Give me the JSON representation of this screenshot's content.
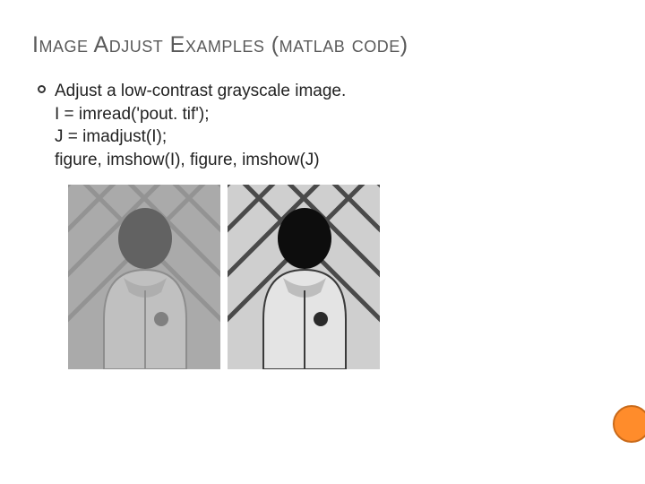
{
  "title": "Image Adjust Examples (matlab code)",
  "bullet": {
    "intro": "Adjust a low-contrast grayscale image.",
    "code": [
      "I = imread('pout. tif');",
      "J = imadjust(I);",
      "figure, imshow(I), figure, imshow(J)"
    ]
  },
  "images": {
    "left_alt": "low-contrast grayscale image (I)",
    "right_alt": "contrast-adjusted grayscale image (J)"
  }
}
